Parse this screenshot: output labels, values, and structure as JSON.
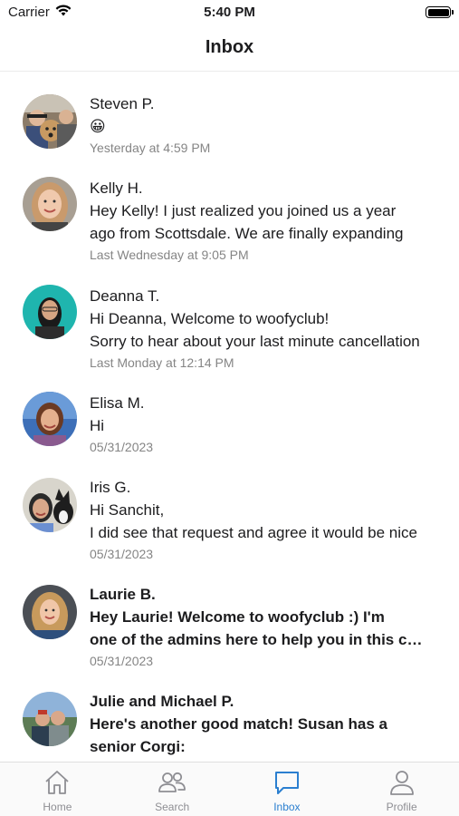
{
  "status_bar": {
    "carrier": "Carrier",
    "time": "5:40 PM"
  },
  "header": {
    "title": "Inbox"
  },
  "messages": [
    {
      "name": "Steven P.",
      "lines": [
        "😀"
      ],
      "time": "Yesterday at 4:59 PM",
      "unread": false
    },
    {
      "name": "Kelly H.",
      "lines": [
        "Hey Kelly! I just realized you joined us a year",
        "ago from Scottsdale. We are finally expanding"
      ],
      "time": "Last Wednesday at 9:05 PM",
      "unread": false
    },
    {
      "name": "Deanna T.",
      "lines": [
        "Hi Deanna, Welcome to woofyclub!",
        "Sorry to hear about your last minute cancellation"
      ],
      "time": "Last Monday at 12:14 PM",
      "unread": false
    },
    {
      "name": "Elisa M.",
      "lines": [
        "Hi"
      ],
      "time": "05/31/2023",
      "unread": false
    },
    {
      "name": "Iris G.",
      "lines": [
        "Hi Sanchit,",
        "I did see that request and agree it would be nice"
      ],
      "time": "05/31/2023",
      "unread": false
    },
    {
      "name": "Laurie B.",
      "lines": [
        "Hey Laurie! Welcome to woofyclub :) I'm",
        "one of the admins here to help you in this community"
      ],
      "time": "05/31/2023",
      "unread": true
    },
    {
      "name": "Julie and Michael P.",
      "lines": [
        "Here's another good match! Susan has a",
        "senior Corgi:"
      ],
      "time": "",
      "unread": true
    }
  ],
  "tabs": [
    {
      "label": "Home",
      "icon": "home-icon",
      "active": false
    },
    {
      "label": "Search",
      "icon": "people-search-icon",
      "active": false
    },
    {
      "label": "Inbox",
      "icon": "chat-bubble-icon",
      "active": true
    },
    {
      "label": "Profile",
      "icon": "person-icon",
      "active": false
    }
  ],
  "colors": {
    "accent": "#2b7fd0",
    "inactive": "#8e8e93",
    "secondary_text": "#858585"
  }
}
